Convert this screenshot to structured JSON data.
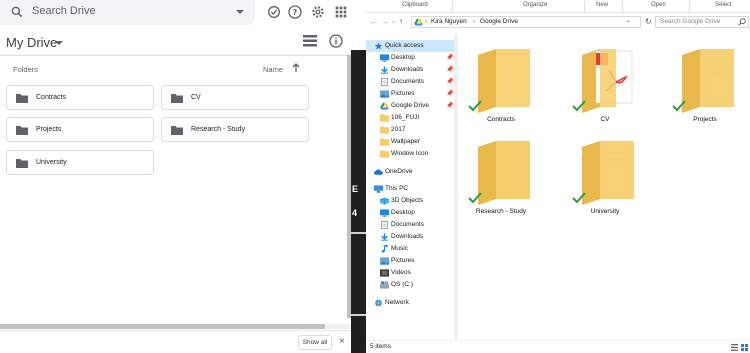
{
  "drive": {
    "search_placeholder": "Search Drive",
    "title": "My Drive",
    "folders_label": "Folders",
    "sort_label": "Name",
    "folders": [
      {
        "name": "Contracts"
      },
      {
        "name": "CV"
      },
      {
        "name": "Projects"
      },
      {
        "name": "Research - Study"
      },
      {
        "name": "University"
      }
    ],
    "show_all_label": "Show all",
    "close_symbol": "×",
    "colors": {
      "folder_icon": "#5f6368",
      "search_bg": "#f1f3f4"
    }
  },
  "strip": {
    "chars": [
      "E",
      "4"
    ]
  },
  "explorer": {
    "ribbon": [
      "Clipboard",
      "Organize",
      "New",
      "Open",
      "Select"
    ],
    "breadcrumb": [
      "Kira Nguyen",
      "Google Drive"
    ],
    "search_placeholder": "Search Google Drive",
    "nav": {
      "quick_access": "Quick access",
      "pinned": [
        "Desktop",
        "Downloads",
        "Documents",
        "Pictures",
        "Google Drive"
      ],
      "recent": [
        "106_FUJI",
        "2017",
        "Wallpaper",
        "Window Icon"
      ],
      "onedrive": "OneDrive",
      "this_pc": "This PC",
      "pc_items": [
        "3D Objects",
        "Desktop",
        "Documents",
        "Downloads",
        "Music",
        "Pictures",
        "Videos",
        "OS (C:)"
      ],
      "network": "Network"
    },
    "folders": [
      {
        "name": "Contracts",
        "synced": true
      },
      {
        "name": "CV",
        "synced": true
      },
      {
        "name": "Projects",
        "synced": true
      },
      {
        "name": "Research - Study",
        "synced": true
      },
      {
        "name": "University",
        "synced": true
      }
    ],
    "status": "5 items",
    "colors": {
      "folder": "#f5cd6a",
      "folder_dark": "#e8b84a",
      "check": "#2e9b3a",
      "selected": "#cce8ff"
    }
  }
}
